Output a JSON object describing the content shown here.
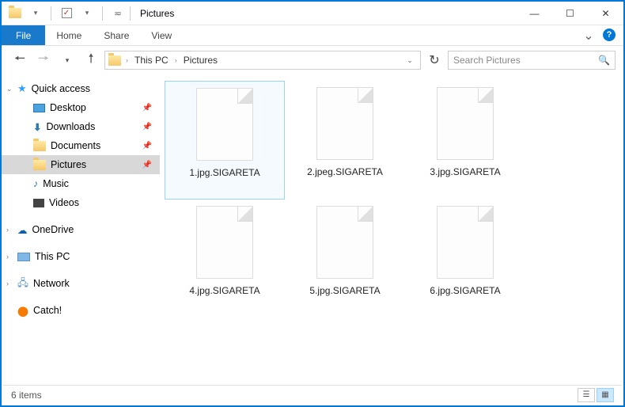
{
  "window": {
    "title": "Pictures",
    "minimize": "—",
    "maximize": "☐",
    "close": "✕"
  },
  "ribbon": {
    "file": "File",
    "tabs": [
      "Home",
      "Share",
      "View"
    ]
  },
  "breadcrumb": {
    "items": [
      "This PC",
      "Pictures"
    ]
  },
  "search": {
    "placeholder": "Search Pictures"
  },
  "sidebar": {
    "quick_access": "Quick access",
    "items": [
      {
        "label": "Desktop",
        "pinned": true
      },
      {
        "label": "Downloads",
        "pinned": true
      },
      {
        "label": "Documents",
        "pinned": true
      },
      {
        "label": "Pictures",
        "pinned": true,
        "selected": true
      },
      {
        "label": "Music",
        "pinned": false
      },
      {
        "label": "Videos",
        "pinned": false
      }
    ],
    "onedrive": "OneDrive",
    "thispc": "This PC",
    "network": "Network",
    "catch": "Catch!"
  },
  "files": [
    {
      "name": "1.jpg.SIGARETA",
      "selected": true
    },
    {
      "name": "2.jpeg.SIGARETA"
    },
    {
      "name": "3.jpg.SIGARETA"
    },
    {
      "name": "4.jpg.SIGARETA"
    },
    {
      "name": "5.jpg.SIGARETA"
    },
    {
      "name": "6.jpg.SIGARETA"
    }
  ],
  "status": {
    "count": "6 items"
  }
}
